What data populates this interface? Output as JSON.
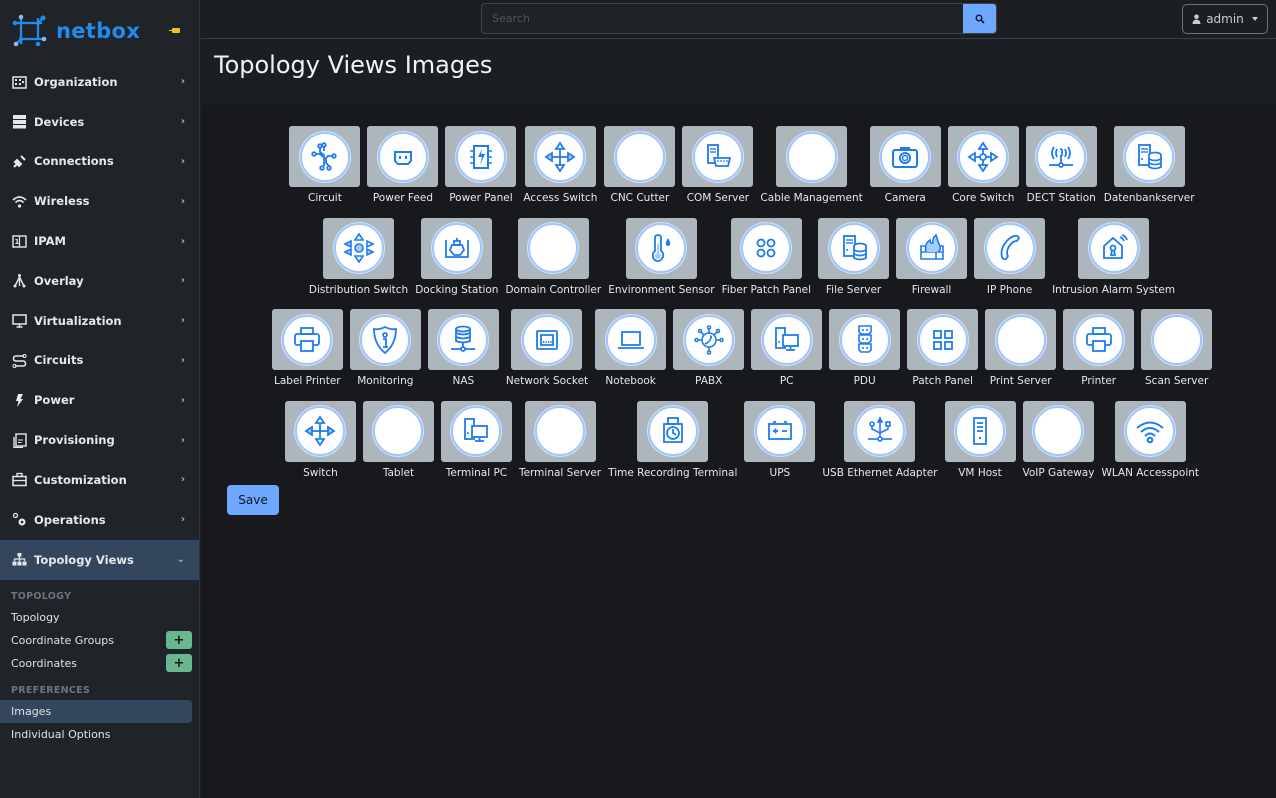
{
  "brand": {
    "name": "netbox",
    "logo_icon": "netbox-logo-icon",
    "pin_icon": "pin-icon"
  },
  "header": {
    "search_placeholder": "Search",
    "search_value": "",
    "user_label": "admin",
    "colors": {
      "accent": "#6ea8fe"
    }
  },
  "sidebar": {
    "items": [
      {
        "label": "Organization",
        "icon": "building-icon"
      },
      {
        "label": "Devices",
        "icon": "server-icon"
      },
      {
        "label": "Connections",
        "icon": "plug-icon"
      },
      {
        "label": "Wireless",
        "icon": "wifi-icon"
      },
      {
        "label": "IPAM",
        "icon": "ip-icon"
      },
      {
        "label": "Overlay",
        "icon": "overlay-icon"
      },
      {
        "label": "Virtualization",
        "icon": "monitor-icon"
      },
      {
        "label": "Circuits",
        "icon": "circuit-icon"
      },
      {
        "label": "Power",
        "icon": "flash-icon"
      },
      {
        "label": "Provisioning",
        "icon": "file-icon"
      },
      {
        "label": "Customization",
        "icon": "toolbox-icon"
      },
      {
        "label": "Operations",
        "icon": "cogs-icon"
      },
      {
        "label": "Topology Views",
        "icon": "sitemap-icon",
        "expanded": true
      }
    ],
    "submenu": {
      "heading_topology": "TOPOLOGY",
      "topology": "Topology",
      "coordinate_groups": "Coordinate Groups",
      "coordinates": "Coordinates",
      "heading_preferences": "PREFERENCES",
      "images": "Images",
      "individual_options": "Individual Options",
      "add_symbol": "+"
    }
  },
  "page": {
    "title": "Topology Views Images",
    "save_label": "Save"
  },
  "tiles": [
    [
      {
        "label": "Circuit",
        "icon": "circuit"
      },
      {
        "label": "Power Feed",
        "icon": "power-feed"
      },
      {
        "label": "Power Panel",
        "icon": "power-panel"
      },
      {
        "label": "Access Switch",
        "icon": "access-switch"
      },
      {
        "label": "CNC Cutter",
        "icon": "blank"
      },
      {
        "label": "COM Server",
        "icon": "com-server"
      },
      {
        "label": "Cable Management",
        "icon": "blank"
      },
      {
        "label": "Camera",
        "icon": "camera"
      },
      {
        "label": "Core Switch",
        "icon": "core-switch"
      },
      {
        "label": "DECT Station",
        "icon": "dect"
      },
      {
        "label": "Datenbankserver",
        "icon": "db-server"
      }
    ],
    [
      {
        "label": "Distribution Switch",
        "icon": "distribution-switch"
      },
      {
        "label": "Docking Station",
        "icon": "docking"
      },
      {
        "label": "Domain Controller",
        "icon": "blank"
      },
      {
        "label": "Environment Sensor",
        "icon": "env-sensor"
      },
      {
        "label": "Fiber Patch Panel",
        "icon": "fiber-patch"
      },
      {
        "label": "File Server",
        "icon": "db-server"
      },
      {
        "label": "Firewall",
        "icon": "firewall"
      },
      {
        "label": "IP Phone",
        "icon": "phone"
      },
      {
        "label": "Intrusion Alarm System",
        "icon": "alarm"
      }
    ],
    [
      {
        "label": "Label Printer",
        "icon": "printer"
      },
      {
        "label": "Monitoring",
        "icon": "shield-info"
      },
      {
        "label": "NAS",
        "icon": "nas"
      },
      {
        "label": "Network Socket",
        "icon": "socket"
      },
      {
        "label": "Notebook",
        "icon": "laptop"
      },
      {
        "label": "PABX",
        "icon": "pabx"
      },
      {
        "label": "PC",
        "icon": "pc"
      },
      {
        "label": "PDU",
        "icon": "pdu"
      },
      {
        "label": "Patch Panel",
        "icon": "patch-panel"
      },
      {
        "label": "Print Server",
        "icon": "blank"
      },
      {
        "label": "Printer",
        "icon": "printer"
      },
      {
        "label": "Scan Server",
        "icon": "blank"
      }
    ],
    [
      {
        "label": "Switch",
        "icon": "access-switch"
      },
      {
        "label": "Tablet",
        "icon": "blank"
      },
      {
        "label": "Terminal PC",
        "icon": "pc"
      },
      {
        "label": "Terminal Server",
        "icon": "blank"
      },
      {
        "label": "Time Recording Terminal",
        "icon": "time-clock"
      },
      {
        "label": "UPS",
        "icon": "battery"
      },
      {
        "label": "USB Ethernet Adapter",
        "icon": "usb"
      },
      {
        "label": "VM Host",
        "icon": "vm-host"
      },
      {
        "label": "VoIP Gateway",
        "icon": "blank"
      },
      {
        "label": "WLAN Accesspoint",
        "icon": "wlan"
      }
    ]
  ]
}
